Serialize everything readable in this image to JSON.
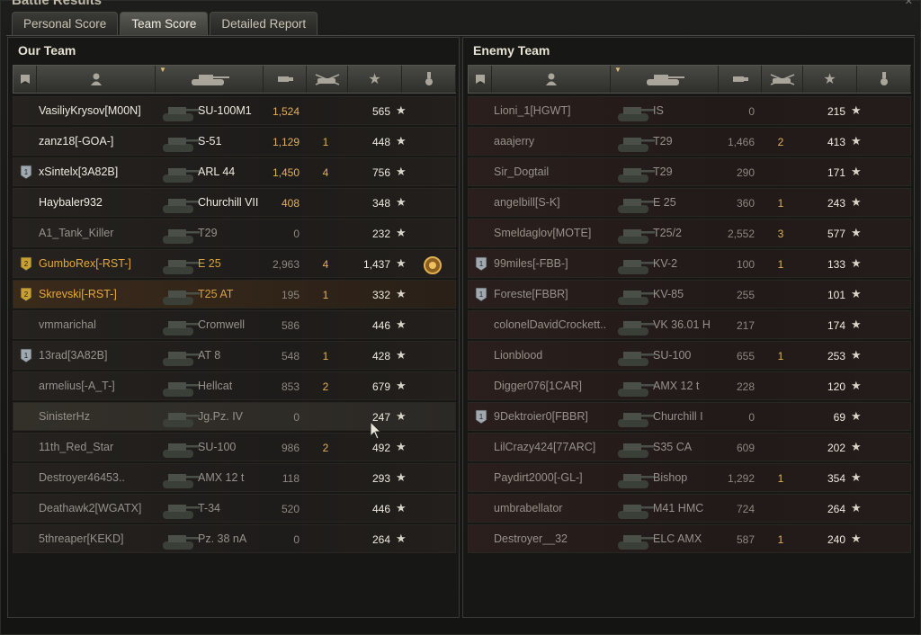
{
  "window": {
    "title": "Battle Results"
  },
  "tabs": [
    {
      "label": "Personal Score",
      "active": false
    },
    {
      "label": "Team Score",
      "active": true
    },
    {
      "label": "Detailed Report",
      "active": false
    }
  ],
  "our_team": {
    "title": "Our Team",
    "rows": [
      {
        "player": "VasiliyKrysov[M00N]",
        "vehicle": "SU-100M1",
        "damage": "1,524",
        "kills": "",
        "xp": "565",
        "alive": true
      },
      {
        "player": "zanz18[-GOA-]",
        "vehicle": "S-51",
        "damage": "1,129",
        "kills": "1",
        "xp": "448",
        "alive": true
      },
      {
        "player": "xSintelx[3A82B]",
        "vehicle": "ARL 44",
        "damage": "1,450",
        "kills": "4",
        "xp": "756",
        "alive": true,
        "badge": "platoon-icon"
      },
      {
        "player": "Haybaler932",
        "vehicle": "Churchill VII",
        "damage": "408",
        "kills": "",
        "xp": "348",
        "alive": true
      },
      {
        "player": "A1_Tank_Killer",
        "vehicle": "T29",
        "damage": "0",
        "kills": "",
        "xp": "232",
        "alive": false
      },
      {
        "player": "GumboRex[-RST-]",
        "vehicle": "E 25",
        "damage": "2,963",
        "kills": "4",
        "xp": "1,437",
        "alive": false,
        "gold": true,
        "badge": "platoon-gold-icon",
        "medal": true
      },
      {
        "player": "Skrevski[-RST-]",
        "vehicle": "T25 AT",
        "damage": "195",
        "kills": "1",
        "xp": "332",
        "alive": false,
        "gold": true,
        "highlight": true,
        "badge": "platoon-gold-icon"
      },
      {
        "player": "vmmarichal",
        "vehicle": "Cromwell",
        "damage": "586",
        "kills": "",
        "xp": "446",
        "alive": false
      },
      {
        "player": "13rad[3A82B]",
        "vehicle": "AT 8",
        "damage": "548",
        "kills": "1",
        "xp": "428",
        "alive": false,
        "badge": "platoon-icon"
      },
      {
        "player": "armelius[-A_T-]",
        "vehicle": "Hellcat",
        "damage": "853",
        "kills": "2",
        "xp": "679",
        "alive": false
      },
      {
        "player": "SinisterHz",
        "vehicle": "Jg.Pz. IV",
        "damage": "0",
        "kills": "",
        "xp": "247",
        "alive": false,
        "hover": true
      },
      {
        "player": "11th_Red_Star",
        "vehicle": "SU-100",
        "damage": "986",
        "kills": "2",
        "xp": "492",
        "alive": false
      },
      {
        "player": "Destroyer46453..",
        "vehicle": "AMX 12 t",
        "damage": "118",
        "kills": "",
        "xp": "293",
        "alive": false
      },
      {
        "player": "Deathawk2[WGATX]",
        "vehicle": "T-34",
        "damage": "520",
        "kills": "",
        "xp": "446",
        "alive": false
      },
      {
        "player": "5threaper[KEKD]",
        "vehicle": "Pz. 38 nA",
        "damage": "0",
        "kills": "",
        "xp": "264",
        "alive": false
      }
    ]
  },
  "enemy_team": {
    "title": "Enemy Team",
    "rows": [
      {
        "player": "Lioni_1[HGWT]",
        "vehicle": "IS",
        "damage": "0",
        "kills": "",
        "xp": "215",
        "alive": false
      },
      {
        "player": "aaajerry",
        "vehicle": "T29",
        "damage": "1,466",
        "kills": "2",
        "xp": "413",
        "alive": false
      },
      {
        "player": "Sir_Dogtail",
        "vehicle": "T29",
        "damage": "290",
        "kills": "",
        "xp": "171",
        "alive": false
      },
      {
        "player": "angelbill[S-K]",
        "vehicle": "E 25",
        "damage": "360",
        "kills": "1",
        "xp": "243",
        "alive": false
      },
      {
        "player": "Smeldaglov[MOTE]",
        "vehicle": "T25/2",
        "damage": "2,552",
        "kills": "3",
        "xp": "577",
        "alive": false
      },
      {
        "player": "99miles[-FBB-]",
        "vehicle": "KV-2",
        "damage": "100",
        "kills": "1",
        "xp": "133",
        "alive": false,
        "badge": "platoon-icon"
      },
      {
        "player": "Foreste[FBBR]",
        "vehicle": "KV-85",
        "damage": "255",
        "kills": "",
        "xp": "101",
        "alive": false,
        "badge": "platoon-icon"
      },
      {
        "player": "colonelDavidCrockett..",
        "vehicle": "VK 36.01 H",
        "damage": "217",
        "kills": "",
        "xp": "174",
        "alive": false
      },
      {
        "player": "Lionblood",
        "vehicle": "SU-100",
        "damage": "655",
        "kills": "1",
        "xp": "253",
        "alive": false
      },
      {
        "player": "Digger076[1CAR]",
        "vehicle": "AMX 12 t",
        "damage": "228",
        "kills": "",
        "xp": "120",
        "alive": false
      },
      {
        "player": "9Dektroier0[FBBR]",
        "vehicle": "Churchill I",
        "damage": "0",
        "kills": "",
        "xp": "69",
        "alive": false,
        "badge": "platoon-icon"
      },
      {
        "player": "LilCrazy424[77ARC]",
        "vehicle": "S35 CA",
        "damage": "609",
        "kills": "",
        "xp": "202",
        "alive": false
      },
      {
        "player": "Paydirt2000[-GL-]",
        "vehicle": "Bishop",
        "damage": "1,292",
        "kills": "1",
        "xp": "354",
        "alive": false
      },
      {
        "player": "umbrabellator",
        "vehicle": "M41 HMC",
        "damage": "724",
        "kills": "",
        "xp": "264",
        "alive": false
      },
      {
        "player": "Destroyer__32",
        "vehicle": "ELC AMX",
        "damage": "587",
        "kills": "1",
        "xp": "240",
        "alive": false
      }
    ]
  },
  "columns": [
    "squad-icon",
    "player-icon",
    "vehicle-icon",
    "damage-icon",
    "kills-icon",
    "xp-star-icon",
    "medal-column-icon"
  ],
  "colors": {
    "gold": "#e8a838",
    "text": "#eeeae0",
    "dim": "#96918a"
  }
}
